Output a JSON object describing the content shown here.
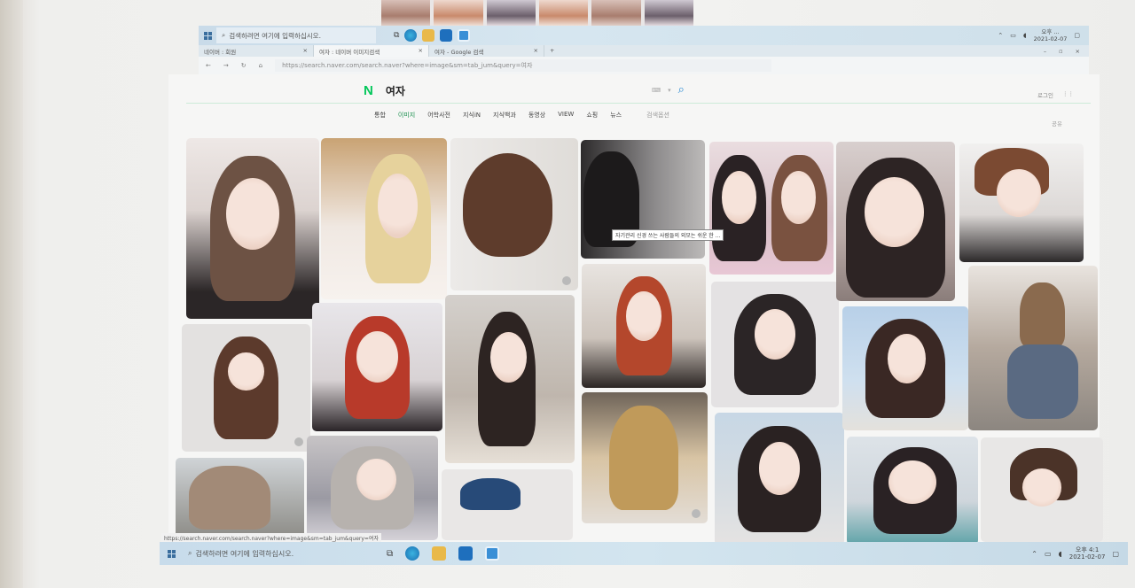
{
  "taskbar_top": {
    "search_placeholder": "검색하려면 여기에 입력하십시오.",
    "time": "오후 ...",
    "date": "2021-02-07"
  },
  "tabs": [
    {
      "label": "네이버 : 회원"
    },
    {
      "label": "여자 : 네이버 이미지검색"
    },
    {
      "label": "여자 - Google 검색"
    }
  ],
  "address": {
    "url": "https://search.naver.com/search.naver?where=image&sm=tab_jum&query=여자"
  },
  "naver": {
    "logo": "N",
    "query": "여자",
    "right_label": "로그인",
    "tabs": [
      "통합",
      "이미지",
      "어학사전",
      "지식iN",
      "지식백과",
      "동영상",
      "VIEW",
      "쇼핑",
      "뉴스"
    ],
    "active_tab_index": 1,
    "options_label": "검색옵션",
    "right_tab": "공유"
  },
  "tooltip": "자기관리 신경 쓰는 사람들의 외모는 쉬운 한 ...",
  "status_url": "https://search.naver.com/search.naver?where=image&sm=tab_jum&query=여자",
  "taskbar_bottom": {
    "search_placeholder": "검색하려면 여기에 입력하십시오.",
    "time": "오후 4:1",
    "date": "2021-02-07"
  },
  "colors": {
    "naver_green": "#03c75a",
    "taskbar": "#cfe0ea",
    "accent_blue": "#2a8ad3"
  },
  "icons": [
    "windows-start-icon",
    "search-icon",
    "edge-icon",
    "file-explorer-icon",
    "mail-icon",
    "store-icon",
    "mic-icon",
    "apps-grid-icon",
    "lens-icon"
  ]
}
